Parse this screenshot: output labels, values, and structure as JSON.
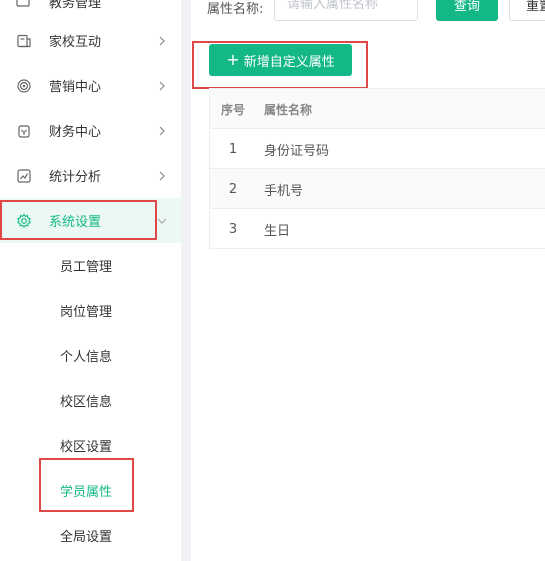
{
  "sidebar": {
    "partial_top": {
      "label": "教务管理",
      "icon": "book-icon"
    },
    "items": [
      {
        "label": "家校互动",
        "icon": "chat-icon",
        "active": false
      },
      {
        "label": "营销中心",
        "icon": "target-icon",
        "active": false
      },
      {
        "label": "财务中心",
        "icon": "wallet-icon",
        "active": false
      },
      {
        "label": "统计分析",
        "icon": "chart-icon",
        "active": false
      },
      {
        "label": "系统设置",
        "icon": "gear-icon",
        "active": true,
        "expanded": true
      }
    ],
    "sub_items": [
      {
        "label": "员工管理",
        "active": false
      },
      {
        "label": "岗位管理",
        "active": false
      },
      {
        "label": "个人信息",
        "active": false
      },
      {
        "label": "校区信息",
        "active": false
      },
      {
        "label": "校区设置",
        "active": false
      },
      {
        "label": "学员属性",
        "active": true
      },
      {
        "label": "全局设置",
        "active": false
      }
    ]
  },
  "filter": {
    "label": "属性名称:",
    "placeholder": "请输入属性名称",
    "search_label": "查询",
    "reset_label": "重置"
  },
  "toolbar": {
    "add_label": "新增自定义属性",
    "add_icon": "plus-icon"
  },
  "table": {
    "headers": [
      "序号",
      "属性名称"
    ],
    "rows": [
      {
        "index": "1",
        "name": "身份证号码"
      },
      {
        "index": "2",
        "name": "手机号"
      },
      {
        "index": "3",
        "name": "生日"
      }
    ]
  },
  "colors": {
    "accent": "#13b886",
    "active_bg": "#ecf8f3",
    "highlight_box": "#e04848"
  }
}
